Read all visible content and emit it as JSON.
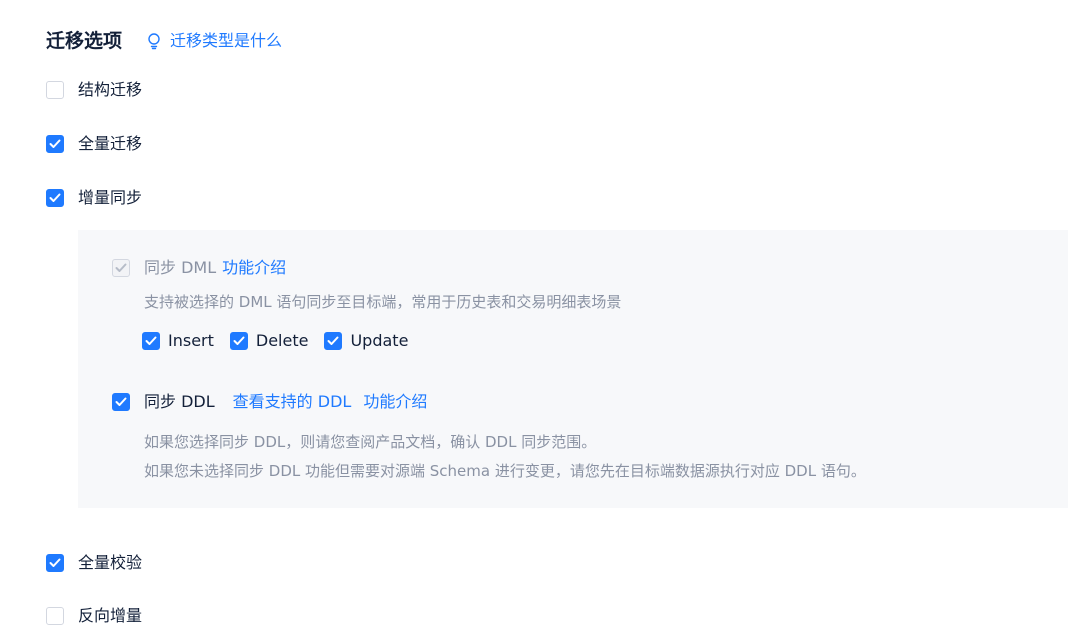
{
  "header": {
    "title": "迁移选项",
    "help_link": "迁移类型是什么"
  },
  "options": {
    "structure": {
      "label": "结构迁移",
      "checked": false
    },
    "full": {
      "label": "全量迁移",
      "checked": true
    },
    "incremental": {
      "label": "增量同步",
      "checked": true
    },
    "full_verify": {
      "label": "全量校验",
      "checked": true
    },
    "reverse": {
      "label": "反向增量",
      "checked": false
    }
  },
  "incremental_panel": {
    "dml": {
      "label": "同步 DML",
      "intro_link": "功能介绍",
      "description": "支持被选择的 DML 语句同步至目标端，常用于历史表和交易明细表场景",
      "ops": [
        {
          "label": "Insert",
          "checked": true
        },
        {
          "label": "Delete",
          "checked": true
        },
        {
          "label": "Update",
          "checked": true
        }
      ]
    },
    "ddl": {
      "label": "同步 DDL",
      "view_link": "查看支持的 DDL",
      "intro_link": "功能介绍",
      "note1": "如果您选择同步 DDL，则请您查阅产品文档，确认 DDL 同步范围。",
      "note2": "如果您未选择同步 DDL 功能但需要对源端 Schema 进行变更，请您先在目标端数据源执行对应 DDL 语句。"
    }
  },
  "colors": {
    "accent": "#1f7aff",
    "text": "#132039",
    "muted": "#8a92a3",
    "panel_bg": "#f7f8fa"
  }
}
